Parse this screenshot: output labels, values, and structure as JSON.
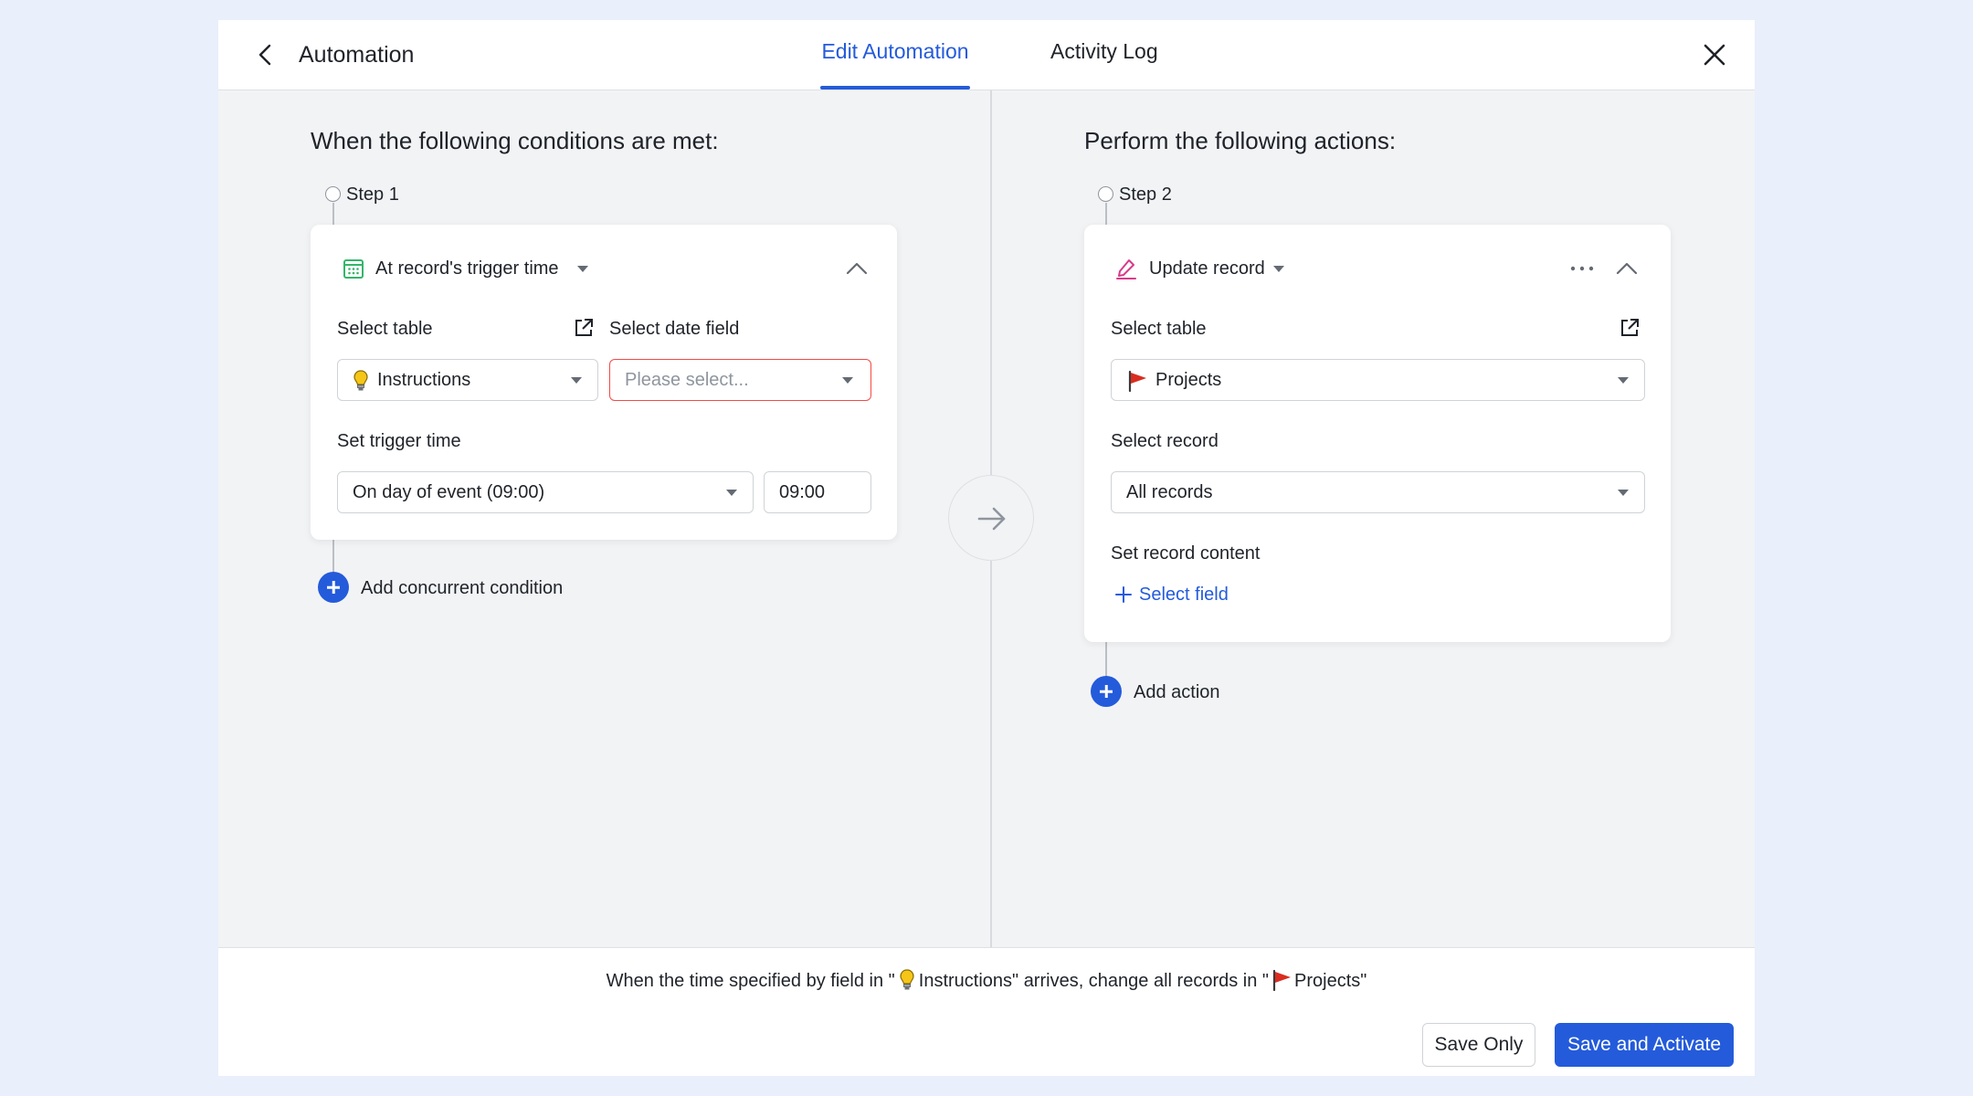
{
  "header": {
    "title": "Automation",
    "tabs": [
      {
        "label": "Edit Automation",
        "active": true
      },
      {
        "label": "Activity Log",
        "active": false
      }
    ]
  },
  "left": {
    "section_title": "When the following conditions are met:",
    "step_label": "Step 1",
    "card": {
      "trigger_label": "At record's trigger time",
      "trigger_icon": "calendar-icon",
      "select_table_label": "Select table",
      "select_table_value": "Instructions",
      "select_table_icon": "lightbulb-icon",
      "select_date_label": "Select date field",
      "select_date_placeholder": "Please select...",
      "trigger_time_label": "Set trigger time",
      "trigger_time_value": "On day of event (09:00)",
      "time_value": "09:00"
    },
    "add_label": "Add concurrent condition"
  },
  "right": {
    "section_title": "Perform the following actions:",
    "step_label": "Step 2",
    "card": {
      "action_label": "Update record",
      "action_icon": "pencil-icon",
      "select_table_label": "Select table",
      "select_table_value": "Projects",
      "select_table_icon": "red-flag-icon",
      "select_record_label": "Select record",
      "select_record_value": "All records",
      "record_content_label": "Set record content",
      "select_field_label": "Select field"
    },
    "add_label": "Add action"
  },
  "footer": {
    "summary_part1": "When the time specified by field in \"",
    "summary_table1": "Instructions",
    "summary_part2": "\" arrives, change all records in \"",
    "summary_table2": "Projects",
    "summary_part3": "\"",
    "save_only": "Save Only",
    "save_activate": "Save and Activate"
  },
  "colors": {
    "primary": "#245bdb",
    "error": "#f54a45",
    "calendar_green": "#34b56a",
    "pencil_pink": "#d83a8b",
    "flag_red": "#d92d20"
  }
}
